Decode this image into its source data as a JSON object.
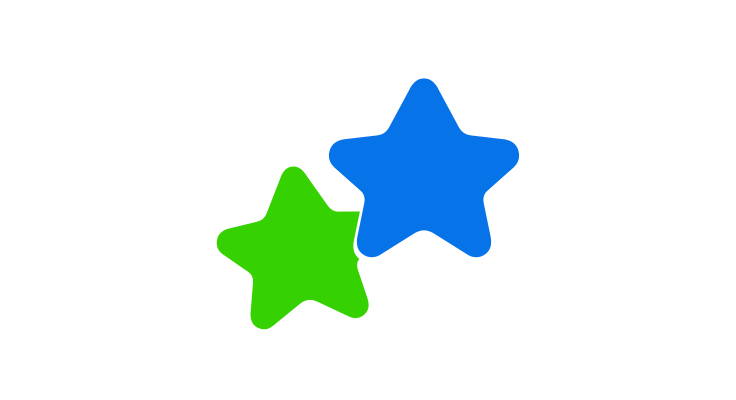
{
  "logo": {
    "icon": "two-stars-icon",
    "colors": {
      "background": "#ffffff",
      "green_star": "#36d100",
      "blue_star": "#0673e8",
      "gap": "#ffffff"
    }
  }
}
